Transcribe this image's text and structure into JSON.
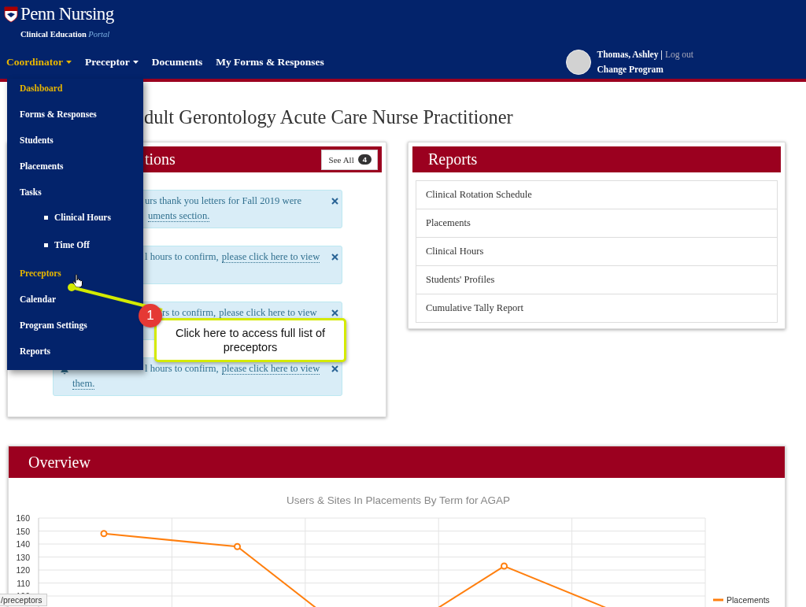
{
  "header": {
    "brand": "Penn Nursing",
    "subtitle": "Clinical Education",
    "subtitle_accent": "Portal",
    "nav": [
      {
        "label": "Coordinator",
        "dropdown": true,
        "selected": true
      },
      {
        "label": "Preceptor",
        "dropdown": true,
        "selected": false
      },
      {
        "label": "Documents",
        "dropdown": false,
        "selected": false
      },
      {
        "label": "My Forms & Responses",
        "dropdown": false,
        "selected": false
      }
    ],
    "user": {
      "name": "Thomas, Ashley",
      "separator": "|",
      "logout": "Log out",
      "change_program": "Change Program"
    }
  },
  "menu": {
    "items": [
      {
        "label": "Dashboard",
        "highlighted": true
      },
      {
        "label": "Forms & Responses",
        "highlighted": false
      },
      {
        "label": "Students",
        "highlighted": false
      },
      {
        "label": "Placements",
        "highlighted": false
      },
      {
        "label": "Tasks",
        "highlighted": false,
        "children": [
          {
            "label": "Clinical Hours",
            "highlighted": false
          },
          {
            "label": "Time Off",
            "highlighted": false
          }
        ]
      },
      {
        "label": "Preceptors",
        "highlighted": true
      },
      {
        "label": "Calendar",
        "highlighted": false
      },
      {
        "label": "Program Settings",
        "highlighted": false
      },
      {
        "label": "Reports",
        "highlighted": false
      }
    ]
  },
  "page_title": "dult Gerontology Acute Care Nurse Practitioner",
  "notifications": {
    "title": "tions",
    "button": "See All",
    "count": "4",
    "alerts": [
      {
        "bell": false,
        "lines": [
          {
            "kind": "clipped",
            "text": "urs thank you letters for Fall 2019 were"
          },
          {
            "kind": "clipped",
            "link": "uments section."
          }
        ]
      },
      {
        "bell": false,
        "lines": [
          {
            "kind": "clipped",
            "text": "l hours to confirm,",
            "link": "please click here to view"
          }
        ]
      },
      {
        "bell": false,
        "lines": [
          {
            "kind": "covered",
            "text": "rs to confirm,",
            "link": "please click here to view"
          }
        ]
      },
      {
        "bell": true,
        "lines": [
          {
            "kind": "clipped",
            "text": "l hours to confirm,",
            "link": "please click here to view"
          },
          {
            "kind": "full",
            "link": "them."
          }
        ]
      }
    ]
  },
  "reports": {
    "title": "Reports",
    "items": [
      "Clinical Rotation Schedule",
      "Placements",
      "Clinical Hours",
      "Students' Profiles",
      "Cumulative Tally Report"
    ]
  },
  "overview": {
    "title": "Overview",
    "chart_data": {
      "type": "line",
      "title": "Users & Sites In Placements By Term for AGAP",
      "grid": true,
      "ylim": [
        50,
        160
      ],
      "yticks": [
        100,
        110,
        120,
        130,
        140,
        150,
        160
      ],
      "series": [
        {
          "name": "Placements",
          "color": "#ff7f0e",
          "marker": "circle",
          "values": [
            148,
            138,
            58,
            123,
            81
          ]
        }
      ]
    }
  },
  "callout": {
    "number": "1",
    "text": "Click here to access full list of preceptors"
  },
  "status_bar": {
    "url": "/preceptors"
  }
}
